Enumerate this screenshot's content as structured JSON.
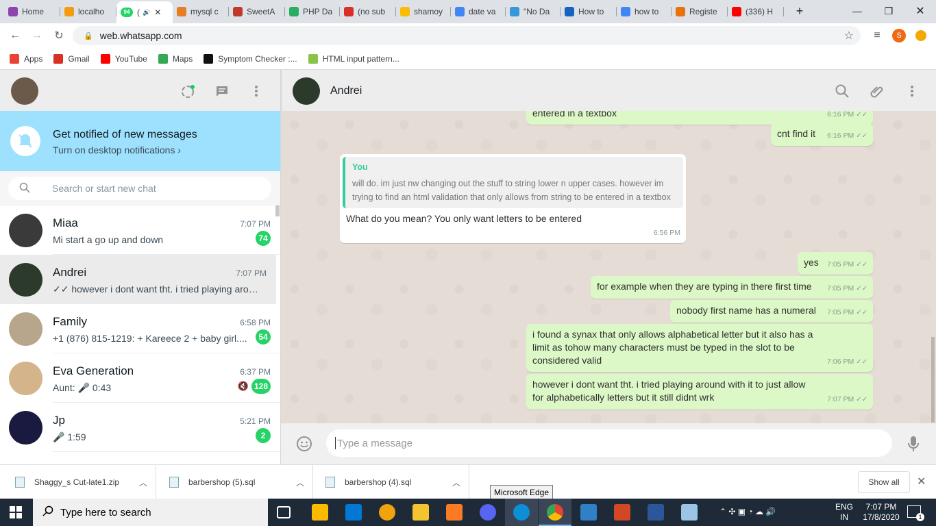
{
  "browser": {
    "tabs": [
      {
        "label": "Home",
        "color": "#8e44ad"
      },
      {
        "label": "localho",
        "color": "#f39c12"
      },
      {
        "label": "(",
        "color": "#25d366",
        "active": true,
        "badge": "94"
      },
      {
        "label": "mysql c",
        "color": "#e67e22"
      },
      {
        "label": "SweetA",
        "color": "#c0392b"
      },
      {
        "label": "PHP Da",
        "color": "#27ae60"
      },
      {
        "label": "(no sub",
        "color": "#d93025"
      },
      {
        "label": "shamoy",
        "color": "#fbbc04"
      },
      {
        "label": "date va",
        "color": "#4285f4"
      },
      {
        "label": "\"No Da",
        "color": "#3498db"
      },
      {
        "label": "How to",
        "color": "#1565c0"
      },
      {
        "label": "how to",
        "color": "#4285f4"
      },
      {
        "label": "Registe",
        "color": "#e8710a"
      },
      {
        "label": "(336) H",
        "color": "#ff0000"
      }
    ],
    "new_tab": "+",
    "url": "web.whatsapp.com",
    "profile_initial": "S",
    "bookmarks": [
      {
        "label": "Apps",
        "color": "#ea4335"
      },
      {
        "label": "Gmail",
        "color": "#d93025"
      },
      {
        "label": "YouTube",
        "color": "#ff0000"
      },
      {
        "label": "Maps",
        "color": "#34a853"
      },
      {
        "label": "Symptom Checker :...",
        "color": "#111111"
      },
      {
        "label": "HTML input pattern...",
        "color": "#8bc34a"
      }
    ]
  },
  "whatsapp": {
    "notification": {
      "title": "Get notified of new messages",
      "link": "Turn on desktop notifications ›"
    },
    "search_placeholder": "Search or start new chat",
    "chats": [
      {
        "name": "Miaa",
        "time": "7:07 PM",
        "preview": "Mi start a go up and down",
        "badge": "74",
        "avatar": "#3a3a3a"
      },
      {
        "name": "Andrei",
        "time": "7:07 PM",
        "preview": "✓✓ however i dont want tht. i tried playing arou...",
        "badge": "",
        "avatar": "#2c3a2c",
        "selected": true
      },
      {
        "name": "Family",
        "time": "6:58 PM",
        "preview": "+1 (876) 815-1219: + Kareece 2 + baby girl....",
        "badge": "54",
        "avatar": "#b8a68c"
      },
      {
        "name": "Eva Generation",
        "time": "6:37 PM",
        "preview": "Aunt: 🎤 0:43",
        "badge": "128",
        "avatar": "#d4b48a",
        "muted": true
      },
      {
        "name": "Jp",
        "time": "5:21 PM",
        "preview": "🎤 1:59",
        "badge": "2",
        "avatar": "#1a1a40"
      }
    ],
    "contact": "Andrei",
    "messages": [
      {
        "dir": "out",
        "text": "entered in a textbox",
        "time": "6:16 PM"
      },
      {
        "dir": "out",
        "text": "cnt find it",
        "time": "6:16 PM"
      },
      {
        "dir": "in",
        "quote_author": "You",
        "quote": "will do. im just nw changing out the stuff to string lower n upper cases. however im trying to find an html validation that only allows from string to be entered in a textbox",
        "text": "What do you mean? You only want letters to be entered",
        "time": "6:56 PM"
      },
      {
        "dir": "out",
        "text": "yes",
        "time": "7:05 PM"
      },
      {
        "dir": "out",
        "text": "for example when they are typing in there first time",
        "time": "7:05 PM"
      },
      {
        "dir": "out",
        "text": "nobody first name has a numeral",
        "time": "7:05 PM"
      },
      {
        "dir": "out",
        "text": "i found a synax that only allows alphabetical letter but it also has a limit as tohow many characters must be typed in the slot to be considered valid",
        "time": "7:06 PM"
      },
      {
        "dir": "out",
        "text": "however i dont want tht. i tried playing around with it to just allow for alphabetically letters but it still didnt wrk",
        "time": "7:07 PM"
      }
    ],
    "compose_placeholder": "Type a message"
  },
  "downloads": {
    "items": [
      "Shaggy_s Cut-late1.zip",
      "barbershop (5).sql",
      "barbershop (4).sql"
    ],
    "show_all": "Show all"
  },
  "tooltip": "Microsoft Edge",
  "taskbar": {
    "search_placeholder": "Type here to search",
    "lang": "ENG",
    "region": "IN",
    "time": "7:07 PM",
    "date": "17/8/2020",
    "notifications": "1"
  }
}
